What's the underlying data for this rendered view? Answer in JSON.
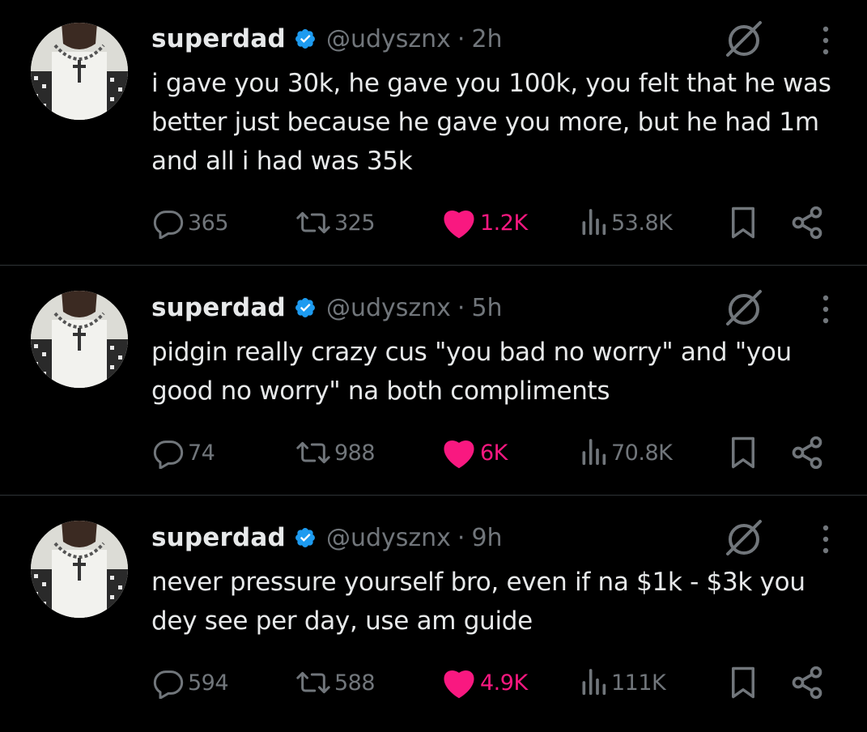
{
  "colors": {
    "background": "#000000",
    "text": "#e7e9ea",
    "muted": "#71767b",
    "like": "#f91880",
    "verified": "#1d9bf0",
    "divider": "#2f3336"
  },
  "icons": {
    "reply": "speech-bubble-icon",
    "retweet": "retweet-arrows-icon",
    "like": "heart-icon-filled",
    "views": "bar-chart-icon",
    "bookmark": "bookmark-icon",
    "share": "share-nodes-icon",
    "grok": "grok-slash-circle-icon",
    "more": "vertical-ellipsis-icon",
    "verified": "verified-badge-icon"
  },
  "tweets": [
    {
      "name": "superdad",
      "handle": "@udysznx",
      "separator": "·",
      "time": "2h",
      "text": "i gave you 30k, he gave you 100k, you felt that he was better just because he gave you more, but he had 1m and all i had was 35k",
      "replies": "365",
      "retweets": "325",
      "likes": "1.2K",
      "views": "53.8K"
    },
    {
      "name": "superdad",
      "handle": "@udysznx",
      "separator": "·",
      "time": "5h",
      "text": "pidgin really crazy cus \"you bad no worry\" and \"you good no worry\" na both compliments",
      "replies": "74",
      "retweets": "988",
      "likes": "6K",
      "views": "70.8K"
    },
    {
      "name": "superdad",
      "handle": "@udysznx",
      "separator": "·",
      "time": "9h",
      "text": "never pressure yourself bro, even if na $1k - $3k you dey see per day, use am guide",
      "replies": "594",
      "retweets": "588",
      "likes": "4.9K",
      "views": "111K"
    }
  ]
}
